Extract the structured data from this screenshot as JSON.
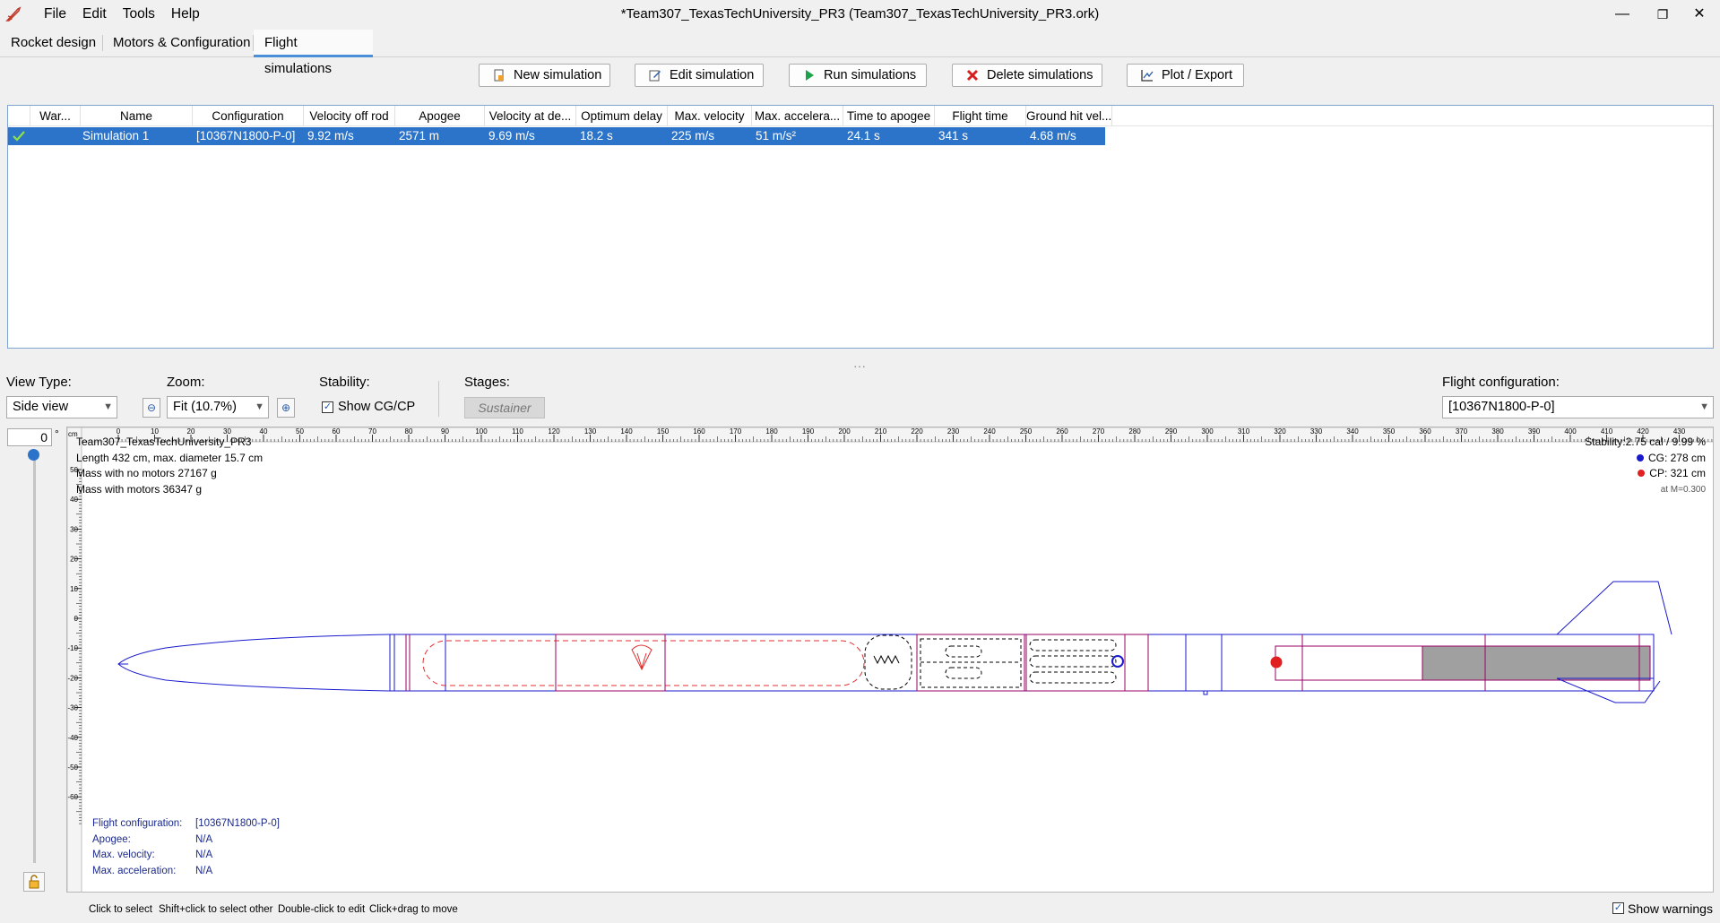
{
  "window": {
    "title": "*Team307_TexasTechUniversity_PR3 (Team307_TexasTechUniversity_PR3.ork)",
    "menu": [
      "File",
      "Edit",
      "Tools",
      "Help"
    ],
    "controls": {
      "minimize": "—",
      "restore": "❐",
      "close": "✕"
    }
  },
  "tabs": [
    "Rocket design",
    "Motors & Configuration",
    "Flight simulations"
  ],
  "toolbar": {
    "new_sim": "New simulation",
    "edit_sim": "Edit simulation",
    "run_sims": "Run simulations",
    "delete_sims": "Delete simulations",
    "plot_export": "Plot / Export"
  },
  "sim_table": {
    "columns": [
      "",
      "War...",
      "Name",
      "Configuration",
      "Velocity off rod",
      "Apogee",
      "Velocity at de...",
      "Optimum delay",
      "Max. velocity",
      "Max. accelera...",
      "Time to apogee",
      "Flight time",
      "Ground hit vel..."
    ],
    "rows": [
      {
        "status_icon": "check-icon",
        "warnings": "",
        "name": "Simulation 1",
        "configuration": "[10367N1800-P-0]",
        "velocity_off_rod": "9.92 m/s",
        "apogee": "2571 m",
        "velocity_at_deployment": "9.69 m/s",
        "optimum_delay": "18.2 s",
        "max_velocity": "225 m/s",
        "max_acceleration": "51 m/s²",
        "time_to_apogee": "24.1 s",
        "flight_time": "341 s",
        "ground_hit_velocity": "4.68 m/s"
      }
    ]
  },
  "splitter_glyph": "···",
  "view_controls": {
    "view_type_label": "View Type:",
    "view_type_value": "Side view",
    "zoom_label": "Zoom:",
    "zoom_value": "Fit (10.7%)",
    "stability_label": "Stability:",
    "show_cgcp_label": "Show CG/CP",
    "show_cgcp_checked": true,
    "stages_label": "Stages:",
    "stage_button": "Sustainer",
    "flight_config_label": "Flight configuration:",
    "flight_config_value": "[10367N1800-P-0]"
  },
  "rotation": {
    "angle": "0",
    "unit": "°"
  },
  "ruler": {
    "unit": "cm",
    "x_ticks": [
      "0",
      "10",
      "20",
      "30",
      "40",
      "50",
      "60",
      "70",
      "80",
      "90",
      "100",
      "110",
      "120",
      "130",
      "140",
      "150",
      "160",
      "170",
      "180",
      "190",
      "200",
      "210",
      "220",
      "230",
      "240",
      "250",
      "260",
      "270",
      "280",
      "290",
      "300",
      "310",
      "320",
      "330",
      "340",
      "350",
      "360",
      "370",
      "380",
      "390",
      "400",
      "410",
      "420",
      "430"
    ],
    "y_ticks": [
      "50",
      "40",
      "30",
      "20",
      "10",
      "0",
      "-10",
      "-20",
      "-30",
      "-40",
      "-50",
      "-60"
    ]
  },
  "rocket_info": {
    "name": "Team307_TexasTechUniversity_PR3",
    "length": "Length 432 cm, max. diameter 15.7 cm",
    "mass_no_motors": "Mass with no motors 27167 g",
    "mass_with_motors": "Mass with motors 36347 g"
  },
  "stability_info": {
    "stability": "Stability:2.75 cal / 9.99 %",
    "cg": "CG: 278 cm",
    "cp": "CP: 321 cm",
    "mach": "at M=0.300"
  },
  "flight_info": {
    "config_label": "Flight configuration:",
    "config_value": "[10367N1800-P-0]",
    "apogee_label": "Apogee:",
    "apogee_value": "N/A",
    "maxvel_label": "Max. velocity:",
    "maxvel_value": "N/A",
    "maxacc_label": "Max. acceleration:",
    "maxacc_value": "N/A"
  },
  "status_bar": {
    "hints": [
      "Click to select",
      "Shift+click to select other",
      "Double-click to edit",
      "Click+drag to move"
    ],
    "show_warnings_label": "Show warnings",
    "show_warnings_checked": true
  },
  "colors": {
    "selection": "#2b74c9",
    "tab_accent": "#4a90d9",
    "rocket_outline": "#1a1acd",
    "internal_outline": "#990066",
    "recovery": "#e03030",
    "motor_fill": "#a0a0a0"
  }
}
